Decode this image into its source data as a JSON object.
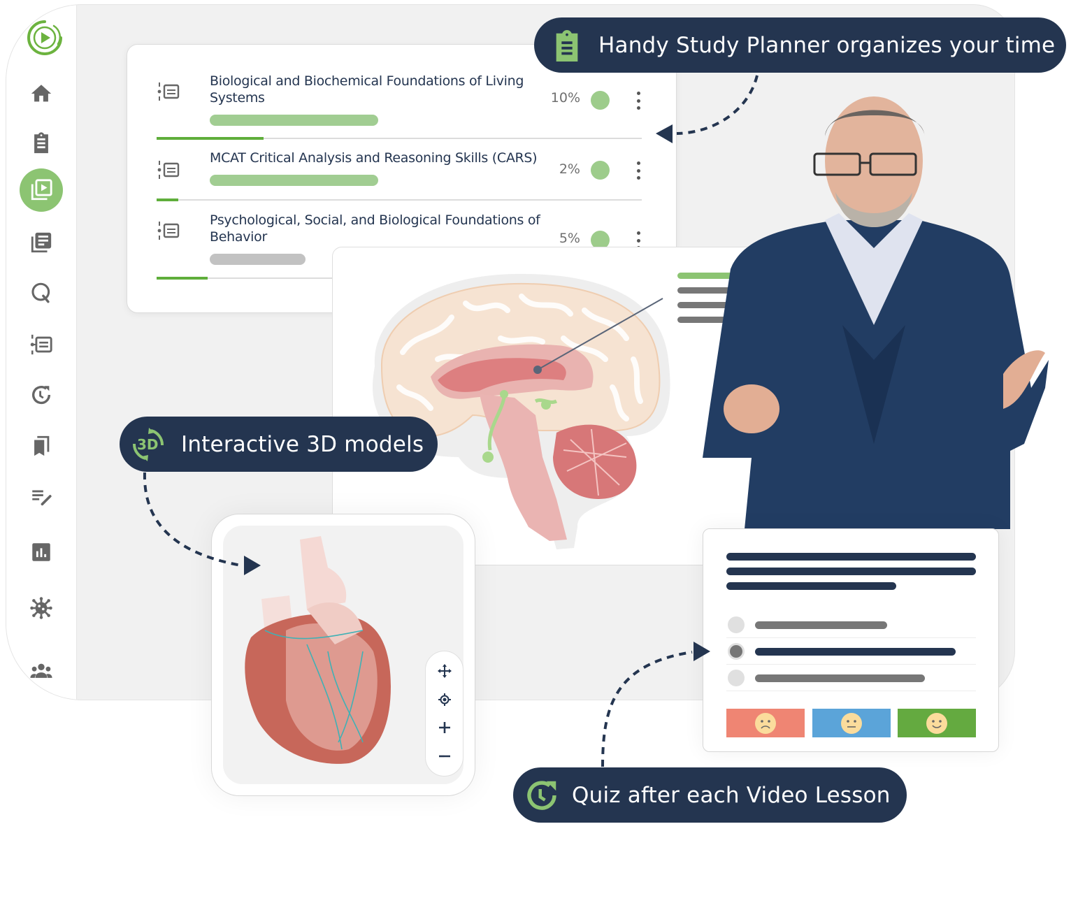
{
  "app": {
    "brand_color": "#6cb33f",
    "navy": "#243550",
    "sidebar": {
      "items": [
        {
          "name": "home",
          "icon": "home-icon"
        },
        {
          "name": "study-planner",
          "icon": "clipboard-icon"
        },
        {
          "name": "video-lessons",
          "icon": "video-library-icon",
          "active": true
        },
        {
          "name": "notes",
          "icon": "library-books-icon"
        },
        {
          "name": "qbank",
          "icon": "q-icon"
        },
        {
          "name": "courses",
          "icon": "course-list-icon"
        },
        {
          "name": "quiz-history",
          "icon": "history-clock-icon"
        },
        {
          "name": "bookmarks",
          "icon": "bookmarks-icon"
        },
        {
          "name": "my-notes",
          "icon": "edit-notes-icon"
        },
        {
          "name": "statistics",
          "icon": "bar-chart-icon"
        },
        {
          "name": "microbe",
          "icon": "microbe-icon"
        },
        {
          "name": "community",
          "icon": "group-icon"
        }
      ]
    }
  },
  "courses": [
    {
      "title": "Biological and Biochemical Foundations of Living Systems",
      "percent": "10%",
      "progress": 0.22,
      "bar_state": "green"
    },
    {
      "title": "MCAT Critical Analysis and Reasoning Skills (CARS)",
      "percent": "2%",
      "progress": 0.045,
      "bar_state": "green"
    },
    {
      "title": "Psychological, Social, and Biological Foundations of Behavior",
      "percent": "5%",
      "progress": 0.105,
      "bar_state": "grey"
    }
  ],
  "callouts": {
    "planner": "Handy Study Planner organizes your time",
    "models": "Interactive 3D models",
    "models_badge": "3D",
    "quiz": "Quiz after each Video Lesson"
  },
  "viewer_controls": [
    {
      "name": "move",
      "icon": "move-icon"
    },
    {
      "name": "center",
      "icon": "target-icon"
    },
    {
      "name": "zoom-in",
      "icon": "plus-icon"
    },
    {
      "name": "zoom-out",
      "icon": "minus-icon"
    }
  ],
  "quiz": {
    "options_selected_index": 1,
    "ratings": [
      {
        "name": "hard",
        "color": "#ef8573",
        "face": "sad"
      },
      {
        "name": "medium",
        "color": "#5ba4d9",
        "face": "neutral"
      },
      {
        "name": "easy",
        "color": "#64aa40",
        "face": "happy"
      }
    ]
  }
}
